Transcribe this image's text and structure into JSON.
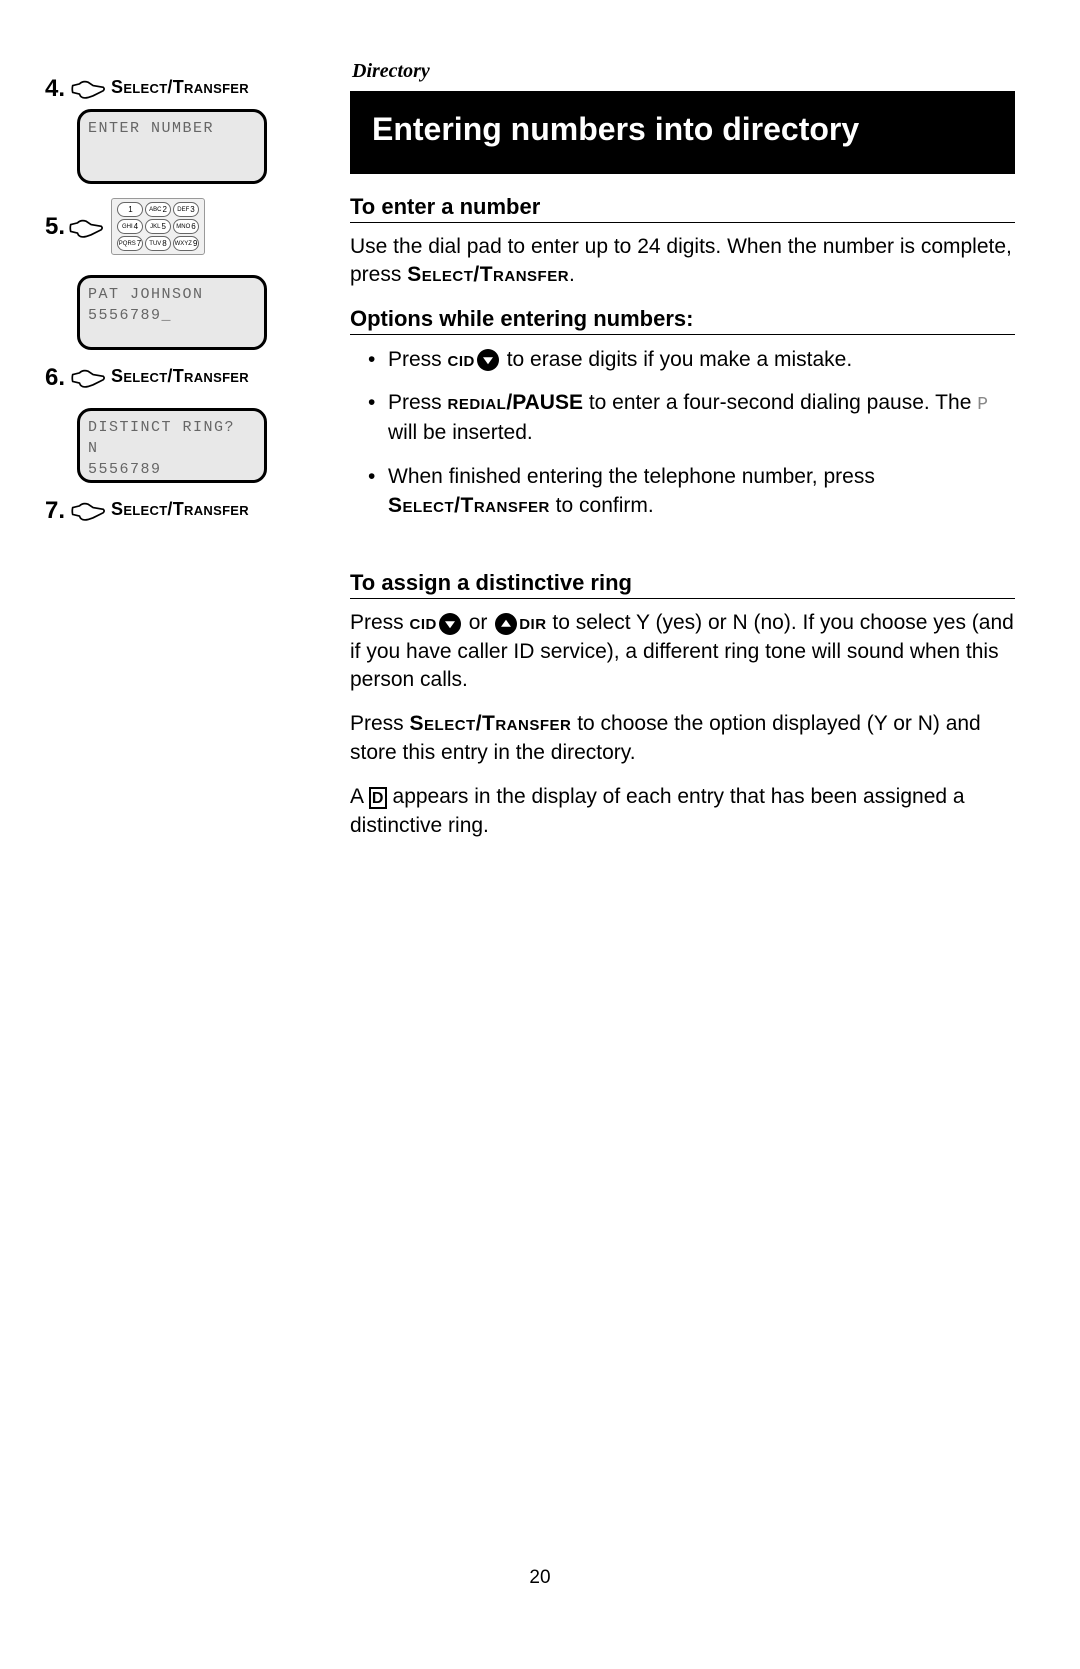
{
  "breadcrumb": "Directory",
  "title": "Entering numbers into directory",
  "left": {
    "steps": [
      {
        "num": "4.",
        "label": "Select/Transfer"
      },
      {
        "num": "5.",
        "label": ""
      },
      {
        "num": "6.",
        "label": "Select/Transfer"
      },
      {
        "num": "7.",
        "label": "Select/Transfer"
      }
    ],
    "screens": {
      "enter_number": {
        "line1": "ENTER NUMBER",
        "line2": ""
      },
      "pat": {
        "line1": "PAT JOHNSON",
        "line2": "5556789_"
      },
      "distinct": {
        "line1": "DISTINCT RING? N",
        "line2": "5556789"
      }
    },
    "keypad": [
      "1",
      "2",
      "3",
      "4",
      "5",
      "6",
      "7",
      "8",
      "9"
    ],
    "keypad_prefix": [
      "",
      "ABC",
      "DEF",
      "GHI",
      "JKL",
      "MNO",
      "PQRS",
      "TUV",
      "WXYZ"
    ]
  },
  "sections": {
    "enter": {
      "heading": "To enter a number",
      "body_pre": "Use the dial pad to enter up to 24 digits. When the number is complete, press ",
      "body_key": "Select/Transfer",
      "body_post": "."
    },
    "options": {
      "heading": "Options while entering numbers:",
      "b1_pre": "Press ",
      "b1_cid": "cid",
      "b1_post": " to erase digits if you make a mistake.",
      "b2_pre": "Press ",
      "b2_key": "redial",
      "b2_mid": "/PAUSE",
      "b2_mid2": " to enter a four-second dialing pause.  The ",
      "b2_p": "P",
      "b2_post": " will be inserted.",
      "b3_pre": "When finished entering the telephone number, press ",
      "b3_key": "Select/Transfer",
      "b3_post": " to confirm."
    },
    "ring": {
      "heading": "To assign a distinctive ring",
      "p1_pre": "Press ",
      "p1_cid": "cid",
      "p1_or": "  or  ",
      "p1_dir": "dir",
      "p1_post": " to select Y (yes) or N (no). If you choose yes (and if you have caller ID service), a different ring tone will sound when this person calls.",
      "p2_pre": "Press ",
      "p2_key": "Select/Transfer",
      "p2_post": " to choose the option displayed (Y or N) and store this entry in the directory.",
      "p3_pre": "A ",
      "p3_d": "D",
      "p3_post": " appears in the display of each entry that has been assigned a distinctive ring."
    }
  },
  "page_number": "20"
}
